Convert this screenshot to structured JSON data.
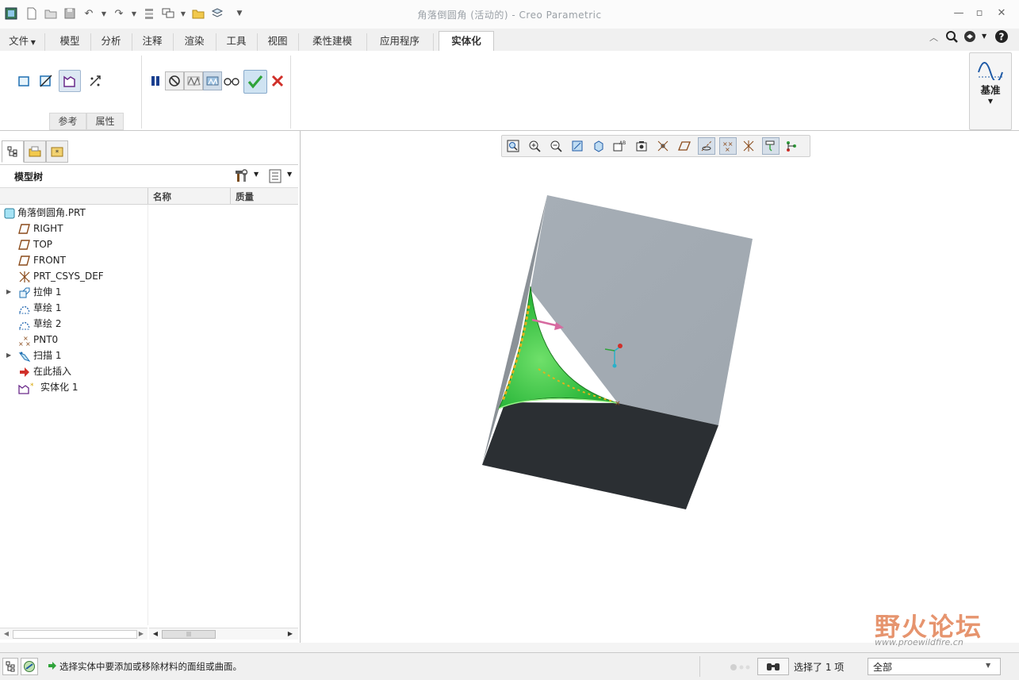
{
  "window": {
    "title": "角落倒圆角 (活动的) - Creo Parametric"
  },
  "tabs": [
    {
      "label": "文件",
      "has_dropdown": true
    },
    {
      "label": "模型"
    },
    {
      "label": "分析"
    },
    {
      "label": "注释"
    },
    {
      "label": "渲染"
    },
    {
      "label": "工具"
    },
    {
      "label": "视图"
    },
    {
      "label": "柔性建模"
    },
    {
      "label": "应用程序"
    },
    {
      "label": "实体化",
      "active": true
    }
  ],
  "ribbon": {
    "groups": [
      {
        "label": "参考"
      },
      {
        "label": "属性"
      }
    ],
    "datum_label": "基准"
  },
  "model_tree": {
    "title": "模型树",
    "columns": [
      "名称",
      "质量"
    ],
    "items": [
      {
        "label": "角落倒圆角.PRT",
        "icon": "part-icon",
        "indent": 0,
        "expandable": false
      },
      {
        "label": "RIGHT",
        "icon": "datum-plane-icon",
        "indent": 1,
        "expandable": false
      },
      {
        "label": "TOP",
        "icon": "datum-plane-icon",
        "indent": 1,
        "expandable": false
      },
      {
        "label": "FRONT",
        "icon": "datum-plane-icon",
        "indent": 1,
        "expandable": false
      },
      {
        "label": "PRT_CSYS_DEF",
        "icon": "csys-icon",
        "indent": 1,
        "expandable": false
      },
      {
        "label": "拉伸 1",
        "icon": "extrude-icon",
        "indent": 1,
        "expandable": true
      },
      {
        "label": "草绘 1",
        "icon": "sketch-icon",
        "indent": 1,
        "expandable": false
      },
      {
        "label": "草绘 2",
        "icon": "sketch-icon",
        "indent": 1,
        "expandable": false
      },
      {
        "label": "PNT0",
        "icon": "datum-point-icon",
        "indent": 1,
        "expandable": false
      },
      {
        "label": "扫描 1",
        "icon": "sweep-icon",
        "indent": 1,
        "expandable": true
      },
      {
        "label": "在此插入",
        "icon": "insert-arrow-icon",
        "indent": 1,
        "expandable": false
      },
      {
        "label": "实体化 1",
        "icon": "solidify-icon",
        "indent": 1,
        "expandable": false
      }
    ]
  },
  "status": {
    "message": "选择实体中要添加或移除材料的面组或曲面。",
    "selection": "选择了 1 项",
    "filter": "全部"
  },
  "watermark": {
    "brand": "野火论坛",
    "url": "www.proewildfire.cn"
  },
  "colors": {
    "accent_green": "#2fa33a",
    "cancel_red": "#d0302a",
    "cube_top": "#a3abb3",
    "cube_side": "#8e949a",
    "cube_front": "#2b2f33",
    "surface_green": "#2db83c"
  }
}
